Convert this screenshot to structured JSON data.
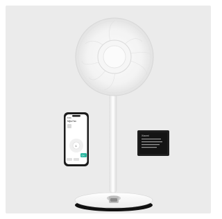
{
  "scene": {
    "background_color": "#ffffff",
    "backdrop_color": "#ebebeb",
    "subject": "fan-icon"
  },
  "phone": {
    "time": "9:41",
    "title": "Mijia Fan",
    "speed_value": "1",
    "accent_color": "#2ab7a0",
    "button_label": "ON"
  },
  "remote": {
    "brand": "Xiaomi",
    "lines": [
      "--------",
      "--------",
      "--------",
      "--------"
    ]
  }
}
